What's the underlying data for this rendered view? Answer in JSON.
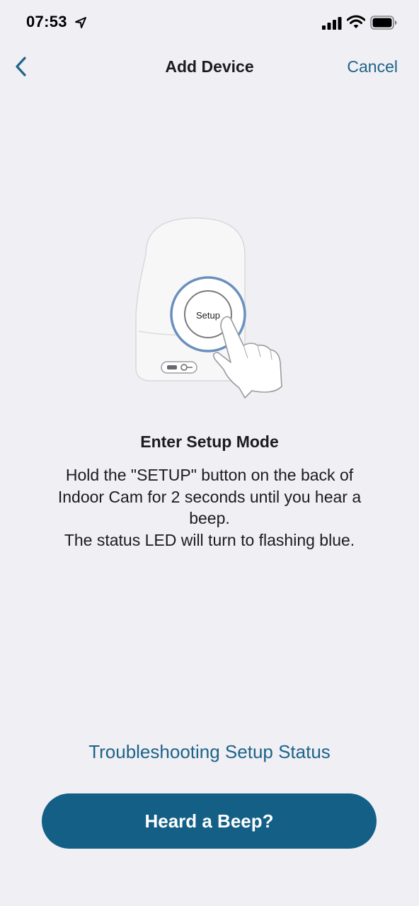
{
  "status_bar": {
    "time": "07:53"
  },
  "nav": {
    "title": "Add Device",
    "cancel_label": "Cancel"
  },
  "illustration": {
    "button_label": "Setup"
  },
  "step": {
    "title": "Enter Setup Mode",
    "description_lines": [
      "Hold the \"SETUP\" button on the back of",
      "Indoor Cam for 2 seconds until you hear a",
      "beep.",
      "The status LED will turn to flashing blue."
    ]
  },
  "troubleshoot_label": "Troubleshooting Setup Status",
  "primary_button_label": "Heard a Beep?",
  "colors": {
    "accent": "#1e6389",
    "button": "#135f86",
    "background": "#efeff4"
  }
}
